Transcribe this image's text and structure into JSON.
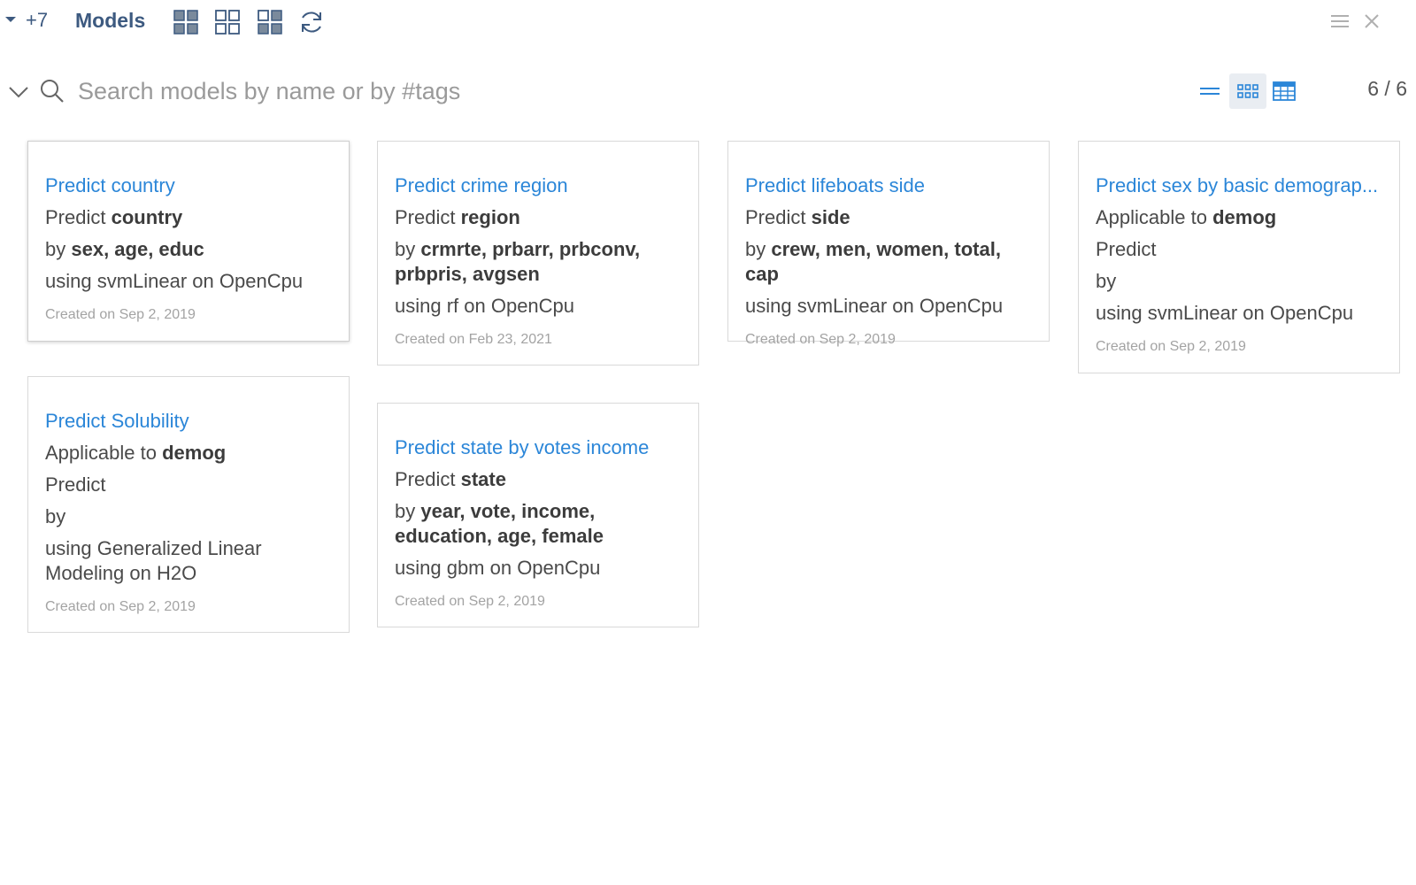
{
  "toolbar": {
    "count": "+7",
    "title": "Models",
    "icons": [
      "grid-2x2-filled-icon",
      "grid-2x2-outline-icon",
      "grid-mixed-icon",
      "refresh-icon"
    ],
    "menu_icon": "hamburger-icon",
    "close_icon": "close-icon"
  },
  "search": {
    "placeholder": "Search models by name or by #tags",
    "value": "",
    "counter": "6 / 6",
    "views": [
      "list-view-icon",
      "card-view-icon",
      "table-view-icon"
    ],
    "active_view": "card-view-icon"
  },
  "cards": [
    {
      "title": "Predict country",
      "applicable_prefix": "",
      "applicable_value": "",
      "predict_prefix": "Predict ",
      "predict_value": "country",
      "by_prefix": "by ",
      "by_value": "sex, age, educ",
      "using": "using svmLinear on OpenCpu",
      "created": "Created on Sep 2, 2019"
    },
    {
      "title": "Predict crime region",
      "applicable_prefix": "",
      "applicable_value": "",
      "predict_prefix": "Predict ",
      "predict_value": "region",
      "by_prefix": "by ",
      "by_value": "crmrte, prbarr, prbconv, prbpris, avgsen",
      "using": "using rf on OpenCpu",
      "created": "Created on Feb 23, 2021"
    },
    {
      "title": "Predict lifeboats side",
      "applicable_prefix": "",
      "applicable_value": "",
      "predict_prefix": "Predict ",
      "predict_value": "side",
      "by_prefix": "by ",
      "by_value": "crew, men, women, total, cap",
      "using": "using svmLinear on OpenCpu",
      "created": "Created on Sep 2, 2019"
    },
    {
      "title": "Predict sex by basic demograp...",
      "applicable_prefix": "Applicable to ",
      "applicable_value": "demog",
      "predict_prefix": "Predict",
      "predict_value": "",
      "by_prefix": "by",
      "by_value": "",
      "using": "using svmLinear on OpenCpu",
      "created": "Created on Sep 2, 2019"
    },
    {
      "title": "Predict Solubility",
      "applicable_prefix": "Applicable to ",
      "applicable_value": "demog",
      "predict_prefix": "Predict",
      "predict_value": "",
      "by_prefix": "by",
      "by_value": "",
      "using": "using Generalized Linear Modeling on H2O",
      "created": "Created on Sep 2, 2019"
    },
    {
      "title": "Predict state by votes income",
      "applicable_prefix": "",
      "applicable_value": "",
      "predict_prefix": "Predict ",
      "predict_value": "state",
      "by_prefix": "by ",
      "by_value": "year, vote, income, education, age, female",
      "using": "using gbm on OpenCpu",
      "created": "Created on Sep 2, 2019"
    }
  ]
}
